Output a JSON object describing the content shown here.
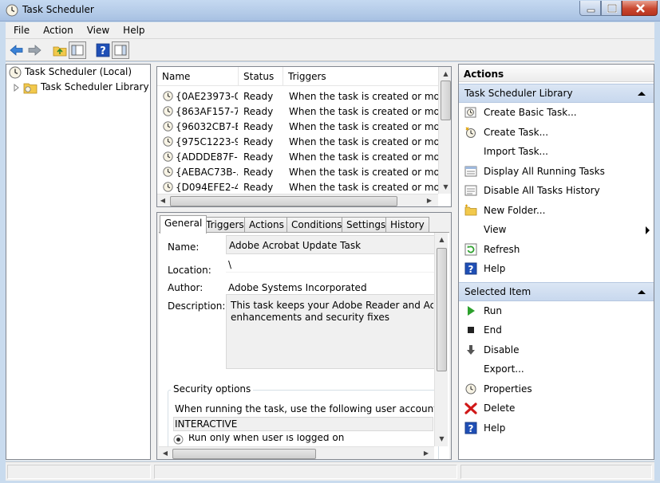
{
  "window": {
    "title": "Task Scheduler"
  },
  "menu": [
    "File",
    "Action",
    "View",
    "Help"
  ],
  "toolbar": {
    "icons": [
      "back-arrow-icon",
      "forward-arrow-icon",
      "up-folder-icon",
      "show-hide-tree-icon",
      "help-icon",
      "show-hide-action-pane-icon"
    ]
  },
  "tree": {
    "root": "Task Scheduler (Local)",
    "library": "Task Scheduler Library"
  },
  "task_list": {
    "columns": [
      "Name",
      "Status",
      "Triggers"
    ],
    "rows": [
      {
        "name": "{0AE23973-0...",
        "status": "Ready",
        "trigger": "When the task is created or modified"
      },
      {
        "name": "{863AF157-7...",
        "status": "Ready",
        "trigger": "When the task is created or modified"
      },
      {
        "name": "{96032CB7-E...",
        "status": "Ready",
        "trigger": "When the task is created or modified"
      },
      {
        "name": "{975C1223-9...",
        "status": "Ready",
        "trigger": "When the task is created or modified"
      },
      {
        "name": "{ADDDE87F-...",
        "status": "Ready",
        "trigger": "When the task is created or modified"
      },
      {
        "name": "{AEBAC73B-...",
        "status": "Ready",
        "trigger": "When the task is created or modified"
      },
      {
        "name": "{D094EFE2-4...",
        "status": "Ready",
        "trigger": "When the task is created or modified"
      }
    ]
  },
  "detail": {
    "tabs": [
      "General",
      "Triggers",
      "Actions",
      "Conditions",
      "Settings",
      "History"
    ],
    "active_tab": "General",
    "fields": {
      "name_label": "Name:",
      "name_value": "Adobe Acrobat Update Task",
      "location_label": "Location:",
      "location_value": "\\",
      "author_label": "Author:",
      "author_value": "Adobe Systems Incorporated",
      "description_label": "Description:",
      "description_value": "This task keeps your Adobe Reader and Acrobat\nenhancements and security fixes"
    },
    "security": {
      "title": "Security options",
      "account_prompt": "When running the task, use the following user account:",
      "account": "INTERACTIVE",
      "option": "Run only when user is logged on"
    }
  },
  "actions": {
    "title": "Actions",
    "sections": [
      {
        "header": "Task Scheduler Library",
        "items": [
          {
            "label": "Create Basic Task...",
            "icon": "create-basic-task-icon"
          },
          {
            "label": "Create Task...",
            "icon": "create-task-icon"
          },
          {
            "label": "Import Task...",
            "icon": ""
          },
          {
            "label": "Display All Running Tasks",
            "icon": "running-tasks-icon"
          },
          {
            "label": "Disable All Tasks History",
            "icon": "tasks-history-icon"
          },
          {
            "label": "New Folder...",
            "icon": "new-folder-icon"
          },
          {
            "label": "View",
            "icon": "",
            "submenu": true
          },
          {
            "label": "Refresh",
            "icon": "refresh-icon"
          },
          {
            "label": "Help",
            "icon": "help-icon"
          }
        ]
      },
      {
        "header": "Selected Item",
        "items": [
          {
            "label": "Run",
            "icon": "run-icon"
          },
          {
            "label": "End",
            "icon": "end-icon"
          },
          {
            "label": "Disable",
            "icon": "disable-icon"
          },
          {
            "label": "Export...",
            "icon": ""
          },
          {
            "label": "Properties",
            "icon": "properties-icon"
          },
          {
            "label": "Delete",
            "icon": "delete-icon"
          },
          {
            "label": "Help",
            "icon": "help-icon"
          }
        ]
      }
    ]
  },
  "colors": {
    "section_header": "#c8d8ee",
    "close_button": "#c9472f",
    "help_blue": "#1f4fb6",
    "delete_red": "#d01818",
    "run_green": "#2ca02c"
  }
}
